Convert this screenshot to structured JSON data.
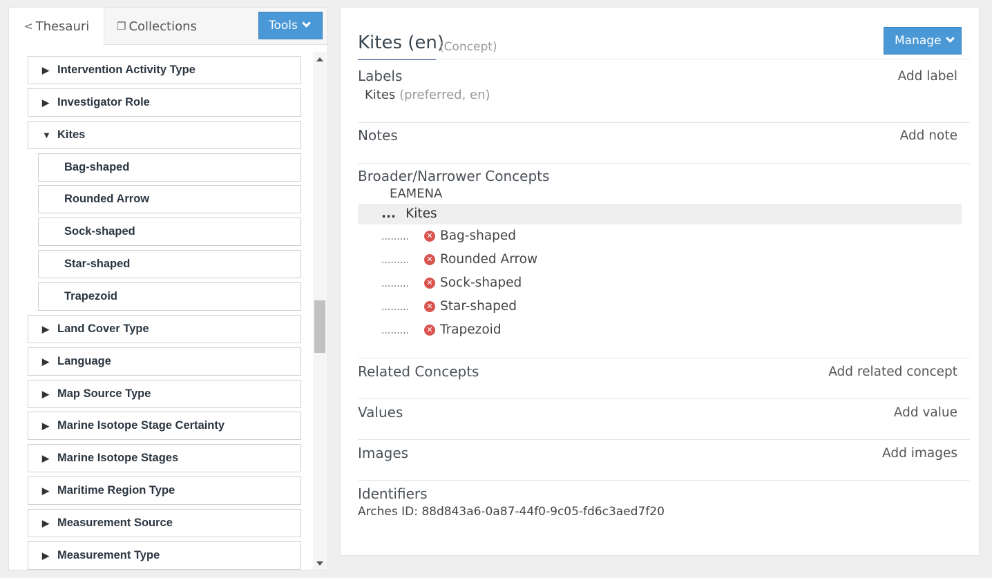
{
  "left_panel": {
    "tabs": [
      {
        "label": "Thesauri",
        "icon": "share-icon"
      },
      {
        "label": "Collections",
        "icon": "copy-icon"
      }
    ],
    "tools_label": "Tools",
    "tree": [
      {
        "label": "Intervention Activity Type",
        "level": 0,
        "state": "collapsed"
      },
      {
        "label": "Investigator Role",
        "level": 0,
        "state": "collapsed"
      },
      {
        "label": "Kites",
        "level": 0,
        "state": "expanded"
      },
      {
        "label": "Bag-shaped",
        "level": 1
      },
      {
        "label": "Rounded Arrow",
        "level": 1
      },
      {
        "label": "Sock-shaped",
        "level": 1
      },
      {
        "label": "Star-shaped",
        "level": 1
      },
      {
        "label": "Trapezoid",
        "level": 1
      },
      {
        "label": "Land Cover Type",
        "level": 0,
        "state": "collapsed"
      },
      {
        "label": "Language",
        "level": 0,
        "state": "collapsed"
      },
      {
        "label": "Map Source Type",
        "level": 0,
        "state": "collapsed"
      },
      {
        "label": "Marine Isotope Stage Certainty",
        "level": 0,
        "state": "collapsed"
      },
      {
        "label": "Marine Isotope Stages",
        "level": 0,
        "state": "collapsed"
      },
      {
        "label": "Maritime Region Type",
        "level": 0,
        "state": "collapsed"
      },
      {
        "label": "Measurement Source",
        "level": 0,
        "state": "collapsed"
      },
      {
        "label": "Measurement Type",
        "level": 0,
        "state": "collapsed"
      }
    ],
    "glyphs": {
      "collapsed": "▶",
      "expanded": "▼"
    }
  },
  "concept": {
    "title": "Kites (en)",
    "type": "(Concept)",
    "manage_label": "Manage"
  },
  "sections": {
    "labels": {
      "title": "Labels",
      "action": "Add label",
      "value": "Kites",
      "qualifier": "(preferred, en)"
    },
    "notes": {
      "title": "Notes",
      "action": "Add note"
    },
    "broader": {
      "title": "Broader/Narrower Concepts",
      "parent": "EAMENA",
      "current_dots": "...",
      "current": "Kites",
      "child_dots": ".........",
      "remove_glyph": "✕",
      "children": [
        "Bag-shaped",
        "Rounded Arrow",
        "Sock-shaped",
        "Star-shaped",
        "Trapezoid"
      ]
    },
    "related": {
      "title": "Related Concepts",
      "action": "Add related concept"
    },
    "values": {
      "title": "Values",
      "action": "Add value"
    },
    "images": {
      "title": "Images",
      "action": "Add images"
    },
    "identifiers": {
      "title": "Identifiers",
      "value": "Arches ID: 88d843a6-0a87-44f0-9c05-fd6c3aed7f20"
    }
  },
  "colors": {
    "primary": "#4a98d6",
    "remove": "#d9534f",
    "accent_underline": "#3a5f9e"
  }
}
